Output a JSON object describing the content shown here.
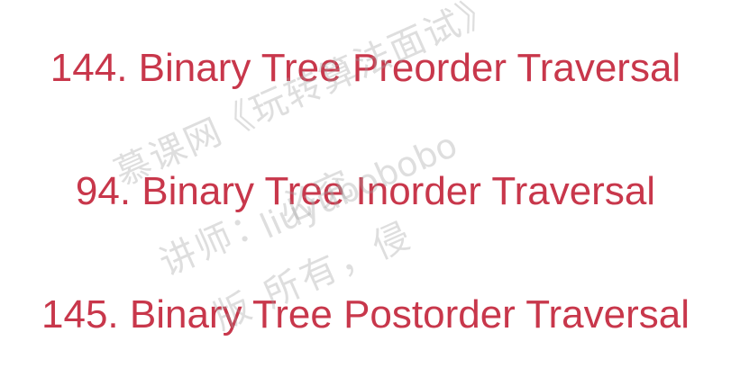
{
  "colors": {
    "title": "#c8374b",
    "background": "#ffffff",
    "watermark": "#a0a0a0"
  },
  "titles": [
    "144. Binary Tree Preorder Traversal",
    "94. Binary Tree Inorder Traversal",
    "145. Binary Tree Postorder Traversal"
  ],
  "watermark": {
    "line1": "《玩转算法面试》",
    "line2": "慕课网",
    "line3": "liuyubobobo",
    "line4": "讲师：     必究",
    "line5": "版 所有，侵"
  }
}
